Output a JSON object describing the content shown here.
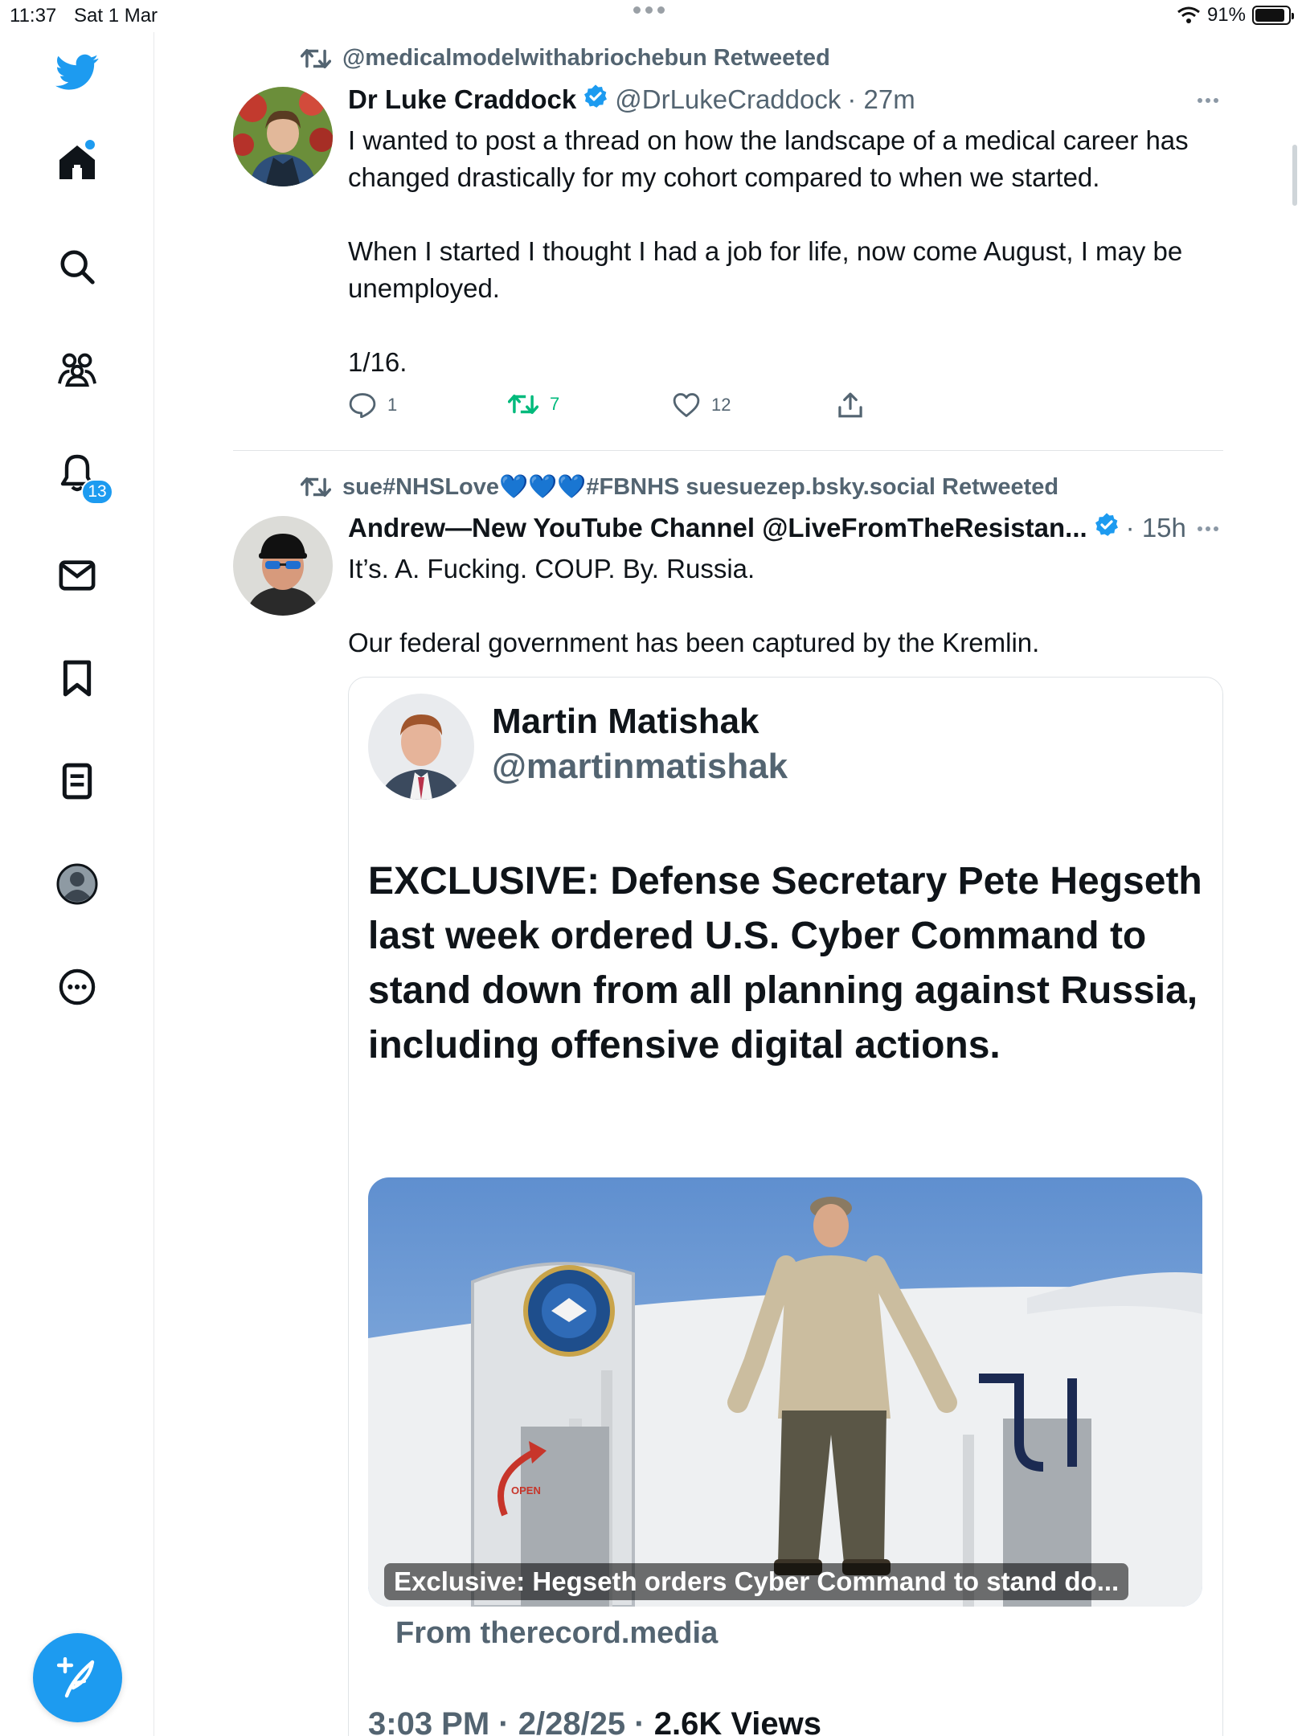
{
  "status_bar": {
    "time": "11:37",
    "date": "Sat 1 Mar",
    "battery": "91%",
    "battery_level": 0.91
  },
  "sidebar": {
    "items": [
      {
        "icon": "twitter-bird-icon"
      },
      {
        "icon": "home-icon"
      },
      {
        "icon": "search-icon"
      },
      {
        "icon": "communities-icon"
      },
      {
        "icon": "notifications-bell-icon",
        "badge": "13"
      },
      {
        "icon": "messages-envelope-icon"
      },
      {
        "icon": "bookmark-icon"
      },
      {
        "icon": "lists-icon"
      },
      {
        "icon": "profile-avatar-icon"
      },
      {
        "icon": "more-circle-icon"
      }
    ],
    "compose_icon": "compose-feather-icon"
  },
  "tweets": [
    {
      "retweeted_by": "@medicalmodelwithabriochebun Retweeted",
      "name": "Dr Luke Craddock",
      "handle": "@DrLukeCraddock",
      "time": "· 27m",
      "paragraphs": [
        "I wanted to post a thread on how the landscape of a medical career has changed drastically for my cohort compared to when we started.",
        "When I started I thought I had a job for life, now come August, I may be unemployed.",
        "1/16."
      ],
      "replies": "1",
      "retweets": "7",
      "likes": "12"
    },
    {
      "retweeted_by": "sue#NHSLove💙💙💙#FBNHS suesuezep.bsky.social Retweeted",
      "name": "Andrew—New YouTube Channel @LiveFromTheResistan...",
      "time": "· 15h",
      "paragraphs": [
        "It’s. A. Fucking. COUP. By. Russia.",
        "Our federal government has been captured by the Kremlin."
      ],
      "quote": {
        "name": "Martin Matishak",
        "handle": "@martinmatishak",
        "headline": "EXCLUSIVE: Defense Secretary Pete Hegseth last week ordered U.S. Cyber Command to stand down from all planning against Russia, including offensive digital actions.",
        "image_caption": "Exclusive: Hegseth orders Cyber Command to stand do...",
        "image_door_label": "OPEN",
        "source": "From therecord.media",
        "meta_time": "3:03 PM · 2/28/25 · ",
        "meta_views": "2.6K Views"
      }
    }
  ]
}
